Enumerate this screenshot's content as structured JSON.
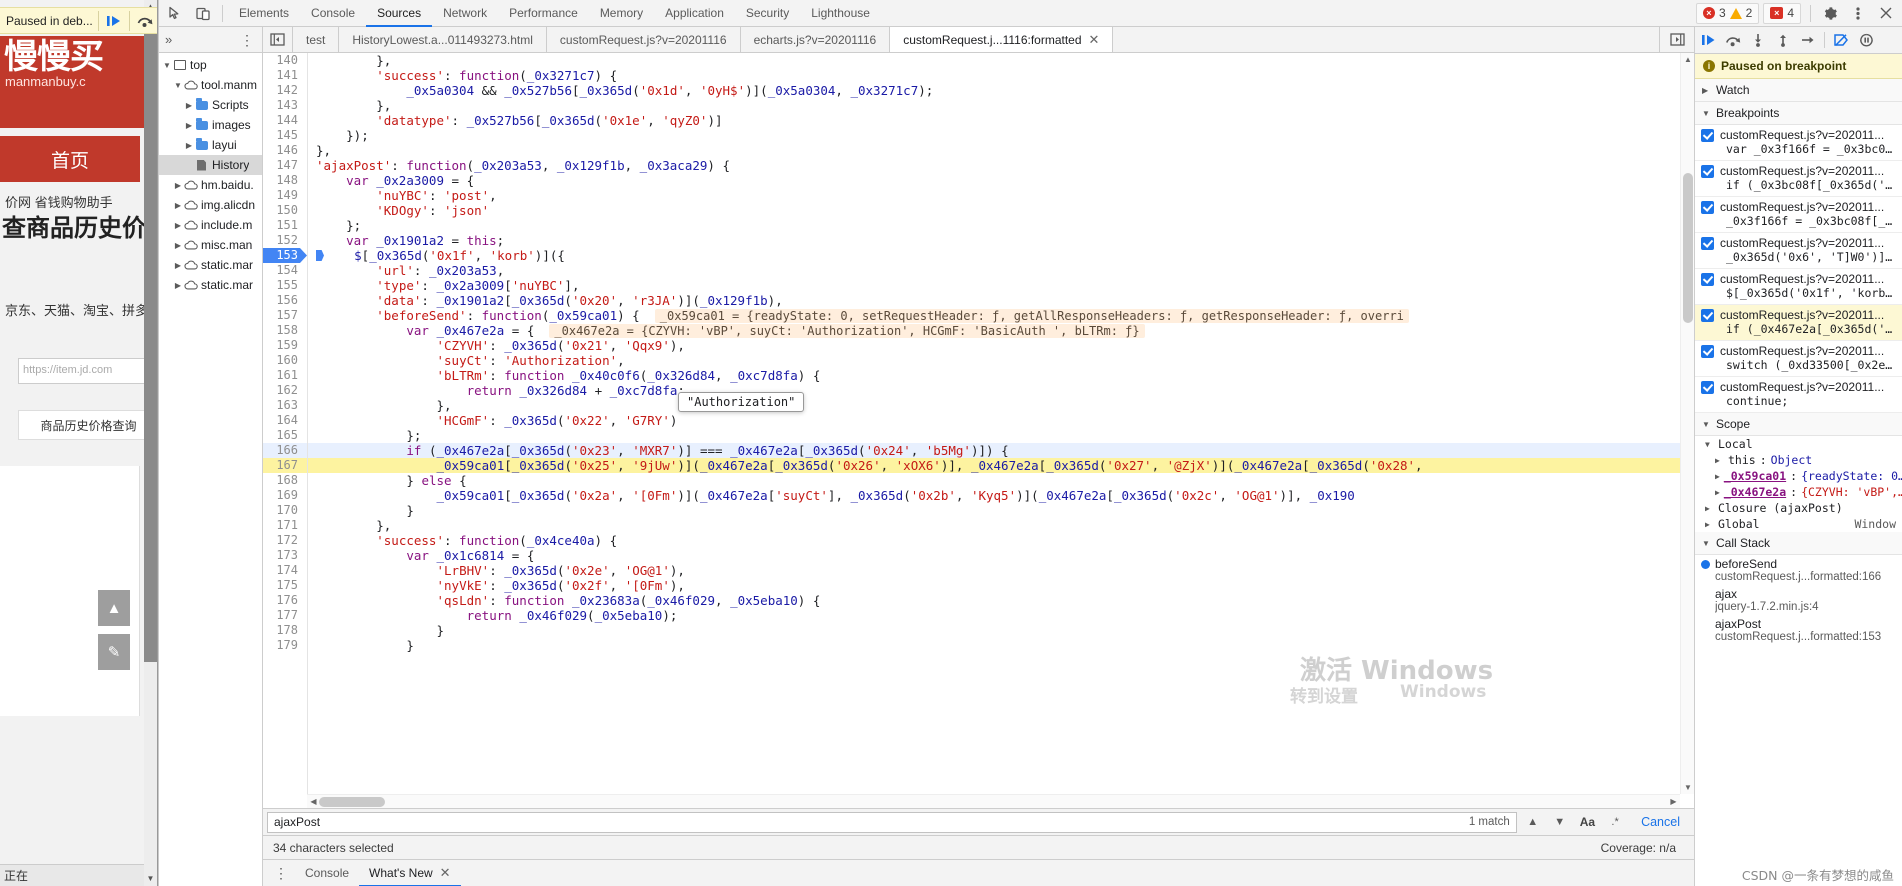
{
  "webpage": {
    "paused_banner": "Paused in deb...",
    "brand_cn": "慢慢买",
    "brand_url": "manmanbuy.c",
    "nav_home": "首页",
    "line1": "价网  省钱购物助手",
    "title": "查商品历史价",
    "line2": "京东、天猫、淘宝、拼多",
    "search_placeholder": "https://item.jd.com",
    "query_button": "商品历史价格查询",
    "footer": "正在",
    "float_up_icon": "upload-icon",
    "float_edit_icon": "pencil-icon"
  },
  "toolbar": {
    "inspect_icon": "inspect-cursor-icon",
    "device_icon": "device-toolbar-icon",
    "tabs": [
      "Elements",
      "Console",
      "Sources",
      "Network",
      "Performance",
      "Memory",
      "Application",
      "Security",
      "Lighthouse"
    ],
    "active_tab": "Sources",
    "errors": "3",
    "warnings": "2",
    "messages": "4",
    "settings_icon": "gear-icon",
    "more_icon": "kebab-menu-icon",
    "close_icon": "close-icon"
  },
  "navigator": {
    "more_icon": "kebab-menu-icon",
    "expand_icon": "chevron-double-right-icon",
    "tree": [
      {
        "label": "top",
        "icon": "frame-icon",
        "twisty": "down",
        "indent": 0,
        "selected": false
      },
      {
        "label": "tool.manm",
        "icon": "cloud-icon",
        "twisty": "down",
        "indent": 1,
        "selected": false
      },
      {
        "label": "Scripts",
        "icon": "folder-icon",
        "twisty": "right",
        "indent": 2,
        "selected": false
      },
      {
        "label": "images",
        "icon": "folder-icon",
        "twisty": "right",
        "indent": 2,
        "selected": false
      },
      {
        "label": "layui",
        "icon": "folder-icon",
        "twisty": "right",
        "indent": 2,
        "selected": false
      },
      {
        "label": "History",
        "icon": "file-icon",
        "twisty": "none",
        "indent": 2,
        "selected": true
      },
      {
        "label": "hm.baidu.",
        "icon": "cloud-icon",
        "twisty": "right",
        "indent": 1,
        "selected": false
      },
      {
        "label": "img.alicdn",
        "icon": "cloud-icon",
        "twisty": "right",
        "indent": 1,
        "selected": false
      },
      {
        "label": "include.m",
        "icon": "cloud-icon",
        "twisty": "right",
        "indent": 1,
        "selected": false
      },
      {
        "label": "misc.man",
        "icon": "cloud-icon",
        "twisty": "right",
        "indent": 1,
        "selected": false
      },
      {
        "label": "static.mar",
        "icon": "cloud-icon",
        "twisty": "right",
        "indent": 1,
        "selected": false
      },
      {
        "label": "static.mar",
        "icon": "cloud-icon",
        "twisty": "right",
        "indent": 1,
        "selected": false
      }
    ]
  },
  "file_tabs": {
    "panel_icon": "collapse-sidebar-icon",
    "tabs": [
      {
        "label": "test",
        "active": false,
        "closable": false
      },
      {
        "label": "HistoryLowest.a...011493273.html",
        "active": false,
        "closable": false
      },
      {
        "label": "customRequest.js?v=20201116",
        "active": false,
        "closable": false
      },
      {
        "label": "echarts.js?v=20201116",
        "active": false,
        "closable": false
      },
      {
        "label": "customRequest.j...1116:formatted",
        "active": true,
        "closable": true
      }
    ],
    "right_icon": "show-navigator-icon"
  },
  "code": {
    "tooltip": "\"Authorization\"",
    "lines": [
      {
        "n": "140",
        "text": "        },",
        "state": ""
      },
      {
        "n": "141",
        "text": "        'success': function(_0x3271c7) {",
        "state": ""
      },
      {
        "n": "142",
        "text": "            _0x5a0304 && _0x527b56[_0x365d('0x1d', '0yH$')](_0x5a0304, _0x3271c7);",
        "state": ""
      },
      {
        "n": "143",
        "text": "        },",
        "state": ""
      },
      {
        "n": "144",
        "text": "        'datatype': _0x527b56[_0x365d('0x1e', 'qyZ0')]",
        "state": ""
      },
      {
        "n": "145",
        "text": "    });",
        "state": ""
      },
      {
        "n": "146",
        "text": "},",
        "state": ""
      },
      {
        "n": "147",
        "text": "'ajaxPost': function(_0x203a53, _0x129f1b, _0x3aca29) {",
        "state": ""
      },
      {
        "n": "148",
        "text": "    var _0x2a3009 = {",
        "state": ""
      },
      {
        "n": "149",
        "text": "        'nuYBC': 'post',",
        "state": ""
      },
      {
        "n": "150",
        "text": "        'KDOgy': 'json'",
        "state": ""
      },
      {
        "n": "151",
        "text": "    };",
        "state": ""
      },
      {
        "n": "152",
        "text": "    var _0x1901a2 = this;",
        "state": ""
      },
      {
        "n": "153",
        "text": "    $[_0x365d('0x1f', 'korb')]({",
        "state": "breakpoint"
      },
      {
        "n": "154",
        "text": "        'url': _0x203a53,",
        "state": ""
      },
      {
        "n": "155",
        "text": "        'type': _0x2a3009['nuYBC'],",
        "state": ""
      },
      {
        "n": "156",
        "text": "        'data': _0x1901a2[_0x365d('0x20', 'r3JA')](_0x129f1b),",
        "state": ""
      },
      {
        "n": "157",
        "text": "        'beforeSend': function(_0x59ca01) {",
        "state": "",
        "hint": "_0x59ca01 = {readyState: 0, setRequestHeader: ƒ, getAllResponseHeaders: ƒ, getResponseHeader: ƒ, overri"
      },
      {
        "n": "158",
        "text": "            var _0x467e2a = {",
        "state": "",
        "hint": "_0x467e2a = {CZYVH: 'vBP', suyCt: 'Authorization', HCGmF: 'BasicAuth ', bLTRm: ƒ}"
      },
      {
        "n": "159",
        "text": "                'CZYVH': _0x365d('0x21', 'Qqx9'),",
        "state": ""
      },
      {
        "n": "160",
        "text": "                'suyCt': 'Authorization',",
        "state": ""
      },
      {
        "n": "161",
        "text": "                'bLTRm': function _0x40c0f6(_0x326d84, _0xc7d8fa) {",
        "state": ""
      },
      {
        "n": "162",
        "text": "                    return _0x326d84 + _0xc7d8fa;",
        "state": ""
      },
      {
        "n": "163",
        "text": "                },",
        "state": ""
      },
      {
        "n": "164",
        "text": "                'HCGmF': _0x365d('0x22', 'G7RY')",
        "state": ""
      },
      {
        "n": "165",
        "text": "            };",
        "state": ""
      },
      {
        "n": "166",
        "text": "            if (_0x467e2a[_0x365d('0x23', 'MXR7')] === _0x467e2a[_0x365d('0x24', 'b5Mg')]) {",
        "state": "execution"
      },
      {
        "n": "167",
        "text": "                _0x59ca01[_0x365d('0x25', '9jUw')](_0x467e2a[_0x365d('0x26', 'xOX6')], _0x467e2a[_0x365d('0x27', '@ZjX')](_0x467e2a[_0x365d('0x28',",
        "state": "highlight"
      },
      {
        "n": "168",
        "text": "            } else {",
        "state": ""
      },
      {
        "n": "169",
        "text": "                _0x59ca01[_0x365d('0x2a', '[0Fm')](_0x467e2a['suyCt'], _0x365d('0x2b', 'Kyq5')](_0x467e2a[_0x365d('0x2c', 'OG@1')], _0x190",
        "state": ""
      },
      {
        "n": "170",
        "text": "            }",
        "state": ""
      },
      {
        "n": "171",
        "text": "        },",
        "state": ""
      },
      {
        "n": "172",
        "text": "        'success': function(_0x4ce40a) {",
        "state": ""
      },
      {
        "n": "173",
        "text": "            var _0x1c6814 = {",
        "state": ""
      },
      {
        "n": "174",
        "text": "                'LrBHV': _0x365d('0x2e', 'OG@1'),",
        "state": ""
      },
      {
        "n": "175",
        "text": "                'nyVkE': _0x365d('0x2f', '[0Fm'),",
        "state": ""
      },
      {
        "n": "176",
        "text": "                'qsLdn': function _0x23683a(_0x46f029, _0x5eba10) {",
        "state": ""
      },
      {
        "n": "177",
        "text": "                    return _0x46f029(_0x5eba10);",
        "state": ""
      },
      {
        "n": "178",
        "text": "                }",
        "state": ""
      },
      {
        "n": "179",
        "text": "            }",
        "state": ""
      }
    ]
  },
  "search": {
    "value": "ajaxPost",
    "match_count": "1 match",
    "prev_icon": "chevron-up-icon",
    "next_icon": "chevron-down-icon",
    "match_case_label": "Aa",
    "regex_icon": "regex-icon",
    "cancel_label": "Cancel"
  },
  "status": {
    "selection": "34 characters selected",
    "coverage": "Coverage: n/a"
  },
  "drawer": {
    "more_icon": "kebab-menu-icon",
    "tabs": [
      {
        "label": "Console",
        "active": false,
        "closable": false
      },
      {
        "label": "What's New",
        "active": true,
        "closable": true
      }
    ]
  },
  "debugger": {
    "buttons": [
      {
        "name": "resume-script-button",
        "icon": "resume-icon"
      },
      {
        "name": "step-over-button",
        "icon": "step-over-icon"
      },
      {
        "name": "step-into-button",
        "icon": "step-into-icon"
      },
      {
        "name": "step-out-button",
        "icon": "step-out-icon"
      },
      {
        "name": "step-button",
        "icon": "step-icon"
      },
      {
        "name": "deactivate-breakpoints-button",
        "icon": "deactivate-breakpoints-icon"
      },
      {
        "name": "pause-on-exceptions-button",
        "icon": "pause-exceptions-icon"
      }
    ],
    "paused_message": "Paused on breakpoint",
    "watch": {
      "title": "Watch",
      "expanded": false
    },
    "breakpoints": {
      "title": "Breakpoints",
      "expanded": true,
      "items": [
        {
          "file": "customRequest.js?v=202011...",
          "code": "var _0x3f166f = _0x3bc0…",
          "checked": true,
          "active": false
        },
        {
          "file": "customRequest.js?v=202011...",
          "code": "if (_0x3bc08f[_0x365d('…",
          "checked": true,
          "active": false
        },
        {
          "file": "customRequest.js?v=202011...",
          "code": "_0x3f166f = _0x3bc08f[_…",
          "checked": true,
          "active": false
        },
        {
          "file": "customRequest.js?v=202011...",
          "code": "_0x365d('0x6', 'T]W0')]…",
          "checked": true,
          "active": false
        },
        {
          "file": "customRequest.js?v=202011...",
          "code": "$[_0x365d('0x1f', 'korb…",
          "checked": true,
          "active": false
        },
        {
          "file": "customRequest.js?v=202011...",
          "code": "if (_0x467e2a[_0x365d('…",
          "checked": true,
          "active": true
        },
        {
          "file": "customRequest.js?v=202011...",
          "code": "switch (_0xd33500[_0x2e…",
          "checked": true,
          "active": false
        },
        {
          "file": "customRequest.js?v=202011...",
          "code": "continue;",
          "checked": true,
          "active": false
        }
      ]
    },
    "scope": {
      "title": "Scope",
      "expanded": true,
      "groups": [
        {
          "label": "Local",
          "expanded": true,
          "items": [
            {
              "name": "this",
              "sep": ": ",
              "value": "Object",
              "value_class": "plain",
              "highlight": false
            },
            {
              "name": "_0x59ca01",
              "sep": ": ",
              "value": "{readyState: 0…",
              "value_class": "plain",
              "highlight": true
            },
            {
              "name": "_0x467e2a",
              "sep": ": ",
              "value": "{CZYVH: 'vBP',…",
              "value_class": "str",
              "highlight": true
            }
          ]
        },
        {
          "label": "Closure (ajaxPost)",
          "expanded": false,
          "items": []
        },
        {
          "label": "Global",
          "expanded": false,
          "items": [],
          "right": "Window"
        }
      ]
    },
    "call_stack": {
      "title": "Call Stack",
      "expanded": true,
      "frames": [
        {
          "name": "beforeSend",
          "location": "customRequest.j...formatted:166"
        },
        {
          "name": "ajax",
          "location": "jquery-1.7.2.min.js:4"
        },
        {
          "name": "ajaxPost",
          "location": "customRequest.j...formatted:153"
        }
      ]
    }
  },
  "watermarks": {
    "activate_cn": "激活 Windows",
    "activate_hint": "转到设置",
    "activate_win": "Windows",
    "credit": "CSDN @一条有梦想的咸鱼"
  }
}
